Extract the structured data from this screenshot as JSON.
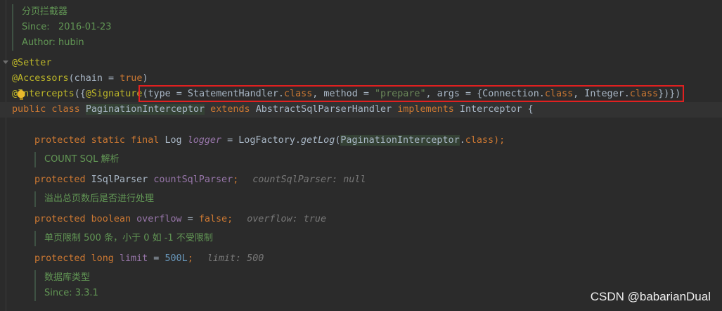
{
  "class_doc": {
    "title": "分页拦截器",
    "since": "Since:   2016-01-23",
    "author": "Author: hubin"
  },
  "lines": {
    "setter": "@Setter",
    "accessors_ann": "@Accessors",
    "accessors_open": "(chain = ",
    "accessors_true": "true",
    "accessors_close": ")",
    "intercepts_ann": "@Intercepts",
    "intercepts_open": "({",
    "signature_ann": "@Signature",
    "sig_type": "(type = StatementHandler.",
    "sig_class1": "class",
    "sig_method": ", method = ",
    "sig_prepare": "\"prepare\"",
    "sig_args": ", args = ",
    "sig_brace_open": "{",
    "sig_conn": "Connection.",
    "sig_class2": "class",
    "sig_integer": ", Integer.",
    "sig_class3": "class",
    "sig_brace_close": "}",
    "sig_end": ")})",
    "class_public": "public class ",
    "class_name": "PaginationInterceptor",
    "class_extends": " extends ",
    "class_parent": "AbstractSqlParserHandler",
    "class_implements": " implements ",
    "class_iface": "Interceptor",
    "class_brace": " {",
    "logger_mods": "protected static final ",
    "logger_type": "Log ",
    "logger_name": "logger",
    "logger_eq": " = LogFactory.",
    "logger_method": "getLog",
    "logger_paren": "(",
    "logger_arg": "PaginationInterceptor",
    "logger_dot": ".",
    "logger_class": "class",
    "logger_end": ");",
    "count_doc": "COUNT SQL 解析",
    "count_mod": "protected ",
    "count_type": "ISqlParser ",
    "count_name": "countSqlParser",
    "count_semi": ";",
    "count_hint": "countSqlParser: null",
    "overflow_doc": "溢出总页数后是否进行处理",
    "overflow_mod": "protected boolean ",
    "overflow_name": "overflow",
    "overflow_eq": " = ",
    "overflow_val": "false",
    "overflow_semi": ";",
    "overflow_hint": "overflow: true",
    "limit_doc": "单页限制 500 条，小于 0 如 -1 不受限制",
    "limit_mod": "protected long ",
    "limit_name": "limit",
    "limit_eq": " = ",
    "limit_val": "500L",
    "limit_semi": ";",
    "limit_hint": "limit: 500",
    "dialect_doc_title": "数据库类型",
    "dialect_doc_since": "Since: 3.3.1"
  },
  "watermark": "CSDN @babarianDual"
}
